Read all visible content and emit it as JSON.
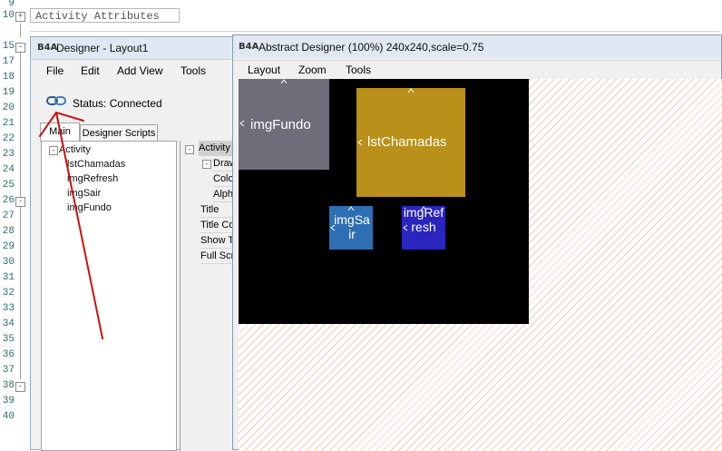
{
  "editor": {
    "line_numbers": [
      "9",
      "10",
      "15",
      "17",
      "18",
      "19",
      "20",
      "21",
      "22",
      "23",
      "24",
      "25",
      "26",
      "27",
      "28",
      "29",
      "30",
      "31",
      "32",
      "33",
      "34",
      "35",
      "36",
      "37",
      "38",
      "39",
      "40"
    ],
    "region_label": "Activity Attributes"
  },
  "designer": {
    "logo": "B4A",
    "title": "Designer - Layout1",
    "menu": [
      "File",
      "Edit",
      "Add View",
      "Tools"
    ],
    "status_label": "Status: Connected",
    "tabs": [
      "Main",
      "Designer Scripts"
    ],
    "tree": {
      "root": "Activity",
      "children": [
        "lstChamadas",
        "imgRefresh",
        "imgSair",
        "imgFundo"
      ]
    },
    "properties": {
      "header": "Activity",
      "rows": [
        "Draw",
        "Colo",
        "Alph",
        "Title",
        "Title Co",
        "Show T",
        "Full Scr"
      ]
    }
  },
  "abstract_designer": {
    "logo": "B4A",
    "title": "Abstract Designer (100%) 240x240,scale=0.75",
    "menu": [
      "Layout",
      "Zoom",
      "Tools"
    ],
    "views": {
      "imgFundo": {
        "label": "imgFundo",
        "color": "#6f6d7a"
      },
      "lstChamadas": {
        "label": "lstChamadas",
        "color": "#b8901a"
      },
      "imgSair": {
        "label": "imgSair",
        "color": "#2e6fb3"
      },
      "imgRefresh": {
        "label": "imgRefresh",
        "color": "#2b25c0"
      }
    }
  },
  "colors": {
    "screen_bg": "#000000",
    "annotation_red": "#cc1111"
  }
}
